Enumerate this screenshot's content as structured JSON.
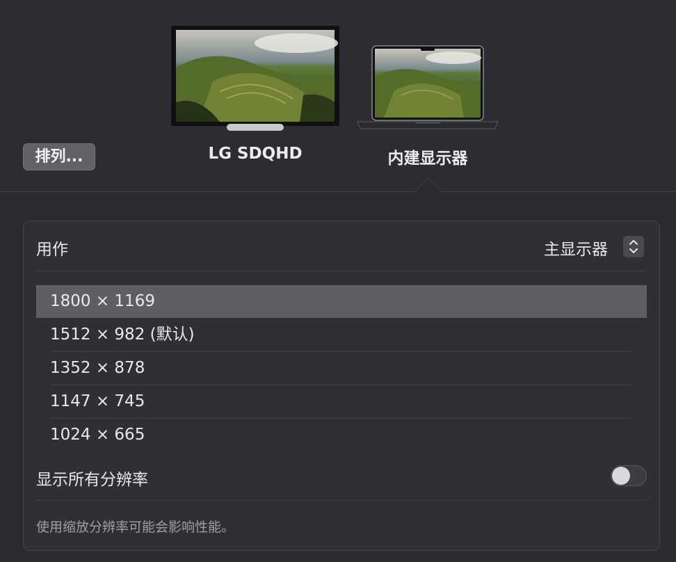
{
  "arrange_button": "排列...",
  "displays": [
    {
      "name": "LG SDQHD"
    },
    {
      "name": "内建显示器"
    }
  ],
  "use_as": {
    "label": "用作",
    "value": "主显示器"
  },
  "resolutions": [
    {
      "label": "1800 × 1169",
      "selected": true
    },
    {
      "label": "1512 × 982 (默认)",
      "selected": false
    },
    {
      "label": "1352 × 878",
      "selected": false
    },
    {
      "label": "1147 × 745",
      "selected": false
    },
    {
      "label": "1024 × 665",
      "selected": false
    }
  ],
  "show_all": {
    "label": "显示所有分辨率",
    "enabled": false
  },
  "note": "使用缩放分辨率可能会影响性能。"
}
